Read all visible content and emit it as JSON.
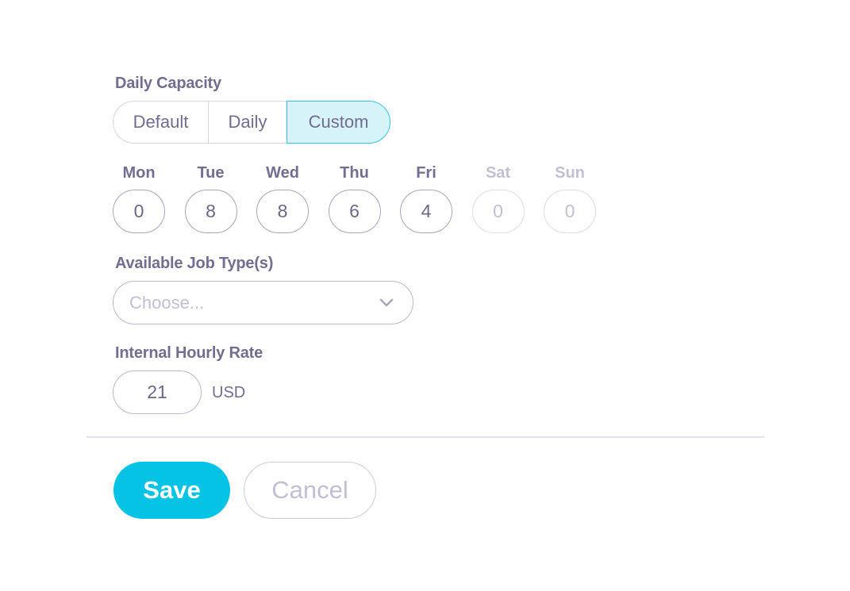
{
  "daily_capacity": {
    "label": "Daily Capacity",
    "options": [
      {
        "label": "Default",
        "selected": false
      },
      {
        "label": "Daily",
        "selected": false
      },
      {
        "label": "Custom",
        "selected": true
      }
    ]
  },
  "days": [
    {
      "name": "Mon",
      "value": "0",
      "enabled": true
    },
    {
      "name": "Tue",
      "value": "8",
      "enabled": true
    },
    {
      "name": "Wed",
      "value": "8",
      "enabled": true
    },
    {
      "name": "Thu",
      "value": "6",
      "enabled": true
    },
    {
      "name": "Fri",
      "value": "4",
      "enabled": true
    },
    {
      "name": "Sat",
      "value": "0",
      "enabled": false
    },
    {
      "name": "Sun",
      "value": "0",
      "enabled": false
    }
  ],
  "job_types": {
    "label": "Available Job Type(s)",
    "placeholder": "Choose...",
    "icon": "chevron-down-icon"
  },
  "hourly_rate": {
    "label": "Internal Hourly Rate",
    "value": "21",
    "currency": "USD"
  },
  "actions": {
    "save_label": "Save",
    "cancel_label": "Cancel"
  },
  "colors": {
    "accent": "#05c3e5",
    "selected_segment_bg": "#d7f3fa",
    "text": "#736d91",
    "muted": "#c3bfd3"
  }
}
